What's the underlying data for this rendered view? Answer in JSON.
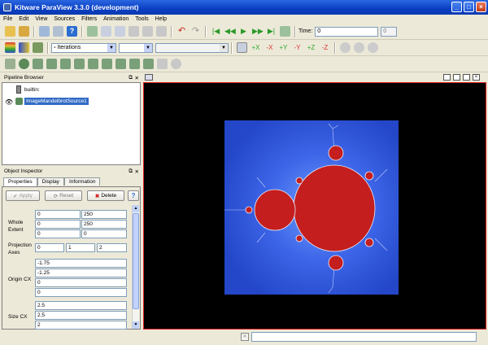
{
  "window": {
    "title": "Kitware ParaView 3.3.0 (development)"
  },
  "menu": [
    "File",
    "Edit",
    "View",
    "Sources",
    "Filters",
    "Animation",
    "Tools",
    "Help"
  ],
  "toolbar": {
    "time_label": "Time:",
    "time_value": "0",
    "time_step": "0",
    "color_by": "Iterations"
  },
  "pipeline": {
    "header": "Pipeline Browser",
    "items": [
      "builtin:",
      "ImageMandelbrotSource1"
    ]
  },
  "inspector": {
    "header": "Object Inspector",
    "tabs": [
      "Properties",
      "Display",
      "Information"
    ],
    "apply": "Apply",
    "reset": "Reset",
    "delete": "Delete",
    "help": "?",
    "whole_extent": {
      "label": "Whole Extent",
      "values": [
        [
          "0",
          "250"
        ],
        [
          "0",
          "250"
        ],
        [
          "0",
          "0"
        ]
      ]
    },
    "projection_axes": {
      "label": "Projection Axes",
      "values": [
        "0",
        "1",
        "2"
      ]
    },
    "origin_cx": {
      "label": "Origin CX",
      "values": [
        "-1.75",
        "-1.25",
        "0",
        "0"
      ]
    },
    "size_cx": {
      "label": "Size CX",
      "values": [
        "2.5",
        "2.5",
        "2"
      ]
    }
  },
  "colors": {
    "title_blue": "#0a3fc4",
    "render_border": "#e02020",
    "fractal_bg": "#2f55d8",
    "fractal_set": "#c41e1e",
    "selection": "#316ac5"
  }
}
